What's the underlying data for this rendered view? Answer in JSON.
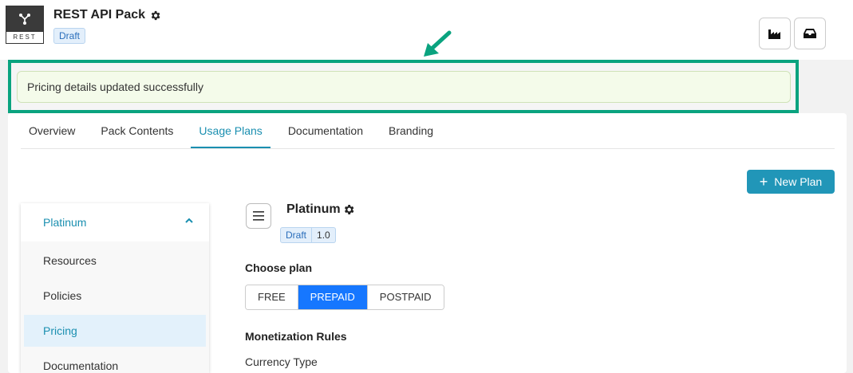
{
  "header": {
    "logo_text": "REST",
    "title": "REST API Pack",
    "status": "Draft",
    "icons": [
      "factory-icon",
      "inbox-icon"
    ]
  },
  "alert": {
    "message": "Pricing details updated successfully"
  },
  "tabs": [
    {
      "label": "Overview"
    },
    {
      "label": "Pack Contents"
    },
    {
      "label": "Usage Plans",
      "active": true
    },
    {
      "label": "Documentation"
    },
    {
      "label": "Branding"
    }
  ],
  "actions": {
    "new_plan": "New Plan"
  },
  "sidemenu": {
    "plan": "Platinum",
    "items": [
      "Resources",
      "Policies",
      "Pricing",
      "Documentation"
    ],
    "selected": "Pricing"
  },
  "plan": {
    "title": "Platinum",
    "status": "Draft",
    "version": "1.0",
    "choose_label": "Choose plan",
    "options": [
      "FREE",
      "PREPAID",
      "POSTPAID"
    ],
    "selected_option": "PREPAID",
    "rules_label": "Monetization Rules",
    "currency_label": "Currency Type"
  },
  "colors": {
    "accent": "#1a8fb0",
    "primary_button": "#2196b8",
    "segment_active": "#1677ff",
    "highlight": "#0aa37f",
    "alert_bg": "#f4fbea"
  }
}
